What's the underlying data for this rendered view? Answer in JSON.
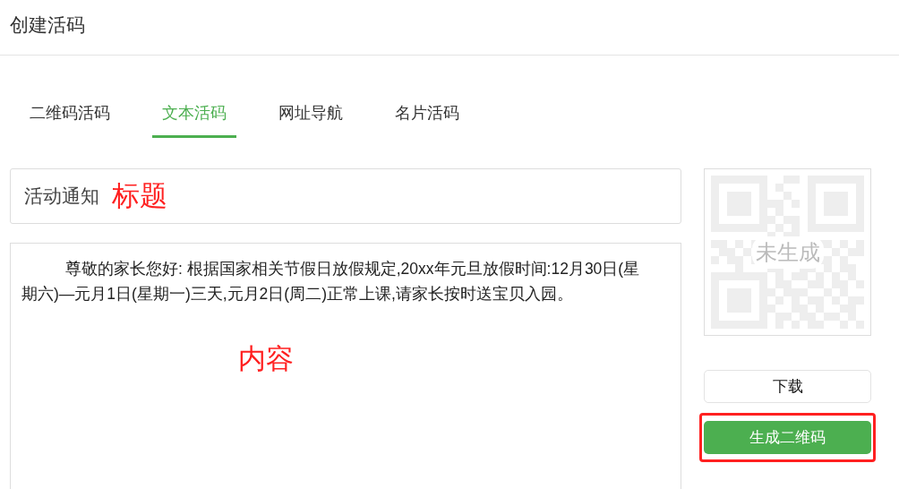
{
  "header": {
    "title": "创建活码"
  },
  "tabs": [
    {
      "label": "二维码活码",
      "selected": false
    },
    {
      "label": "文本活码",
      "selected": true
    },
    {
      "label": "网址导航",
      "selected": false
    },
    {
      "label": "名片活码",
      "selected": false
    }
  ],
  "title_field": {
    "value": "活动通知",
    "annotation": "标题"
  },
  "content_field": {
    "value": "尊敬的家长您好: 根据国家相关节假日放假规定,20xx年元旦放假时间:12月30日(星期六)—元月1日(星期一)三天,元月2日(周二)正常上课,请家长按时送宝贝入园。",
    "annotation": "内容"
  },
  "qr_preview": {
    "status": "未生成"
  },
  "buttons": [
    {
      "label": "下载",
      "kind": "plain",
      "highlighted": false
    },
    {
      "label": "生成二维码",
      "kind": "primary",
      "highlighted": true
    }
  ]
}
